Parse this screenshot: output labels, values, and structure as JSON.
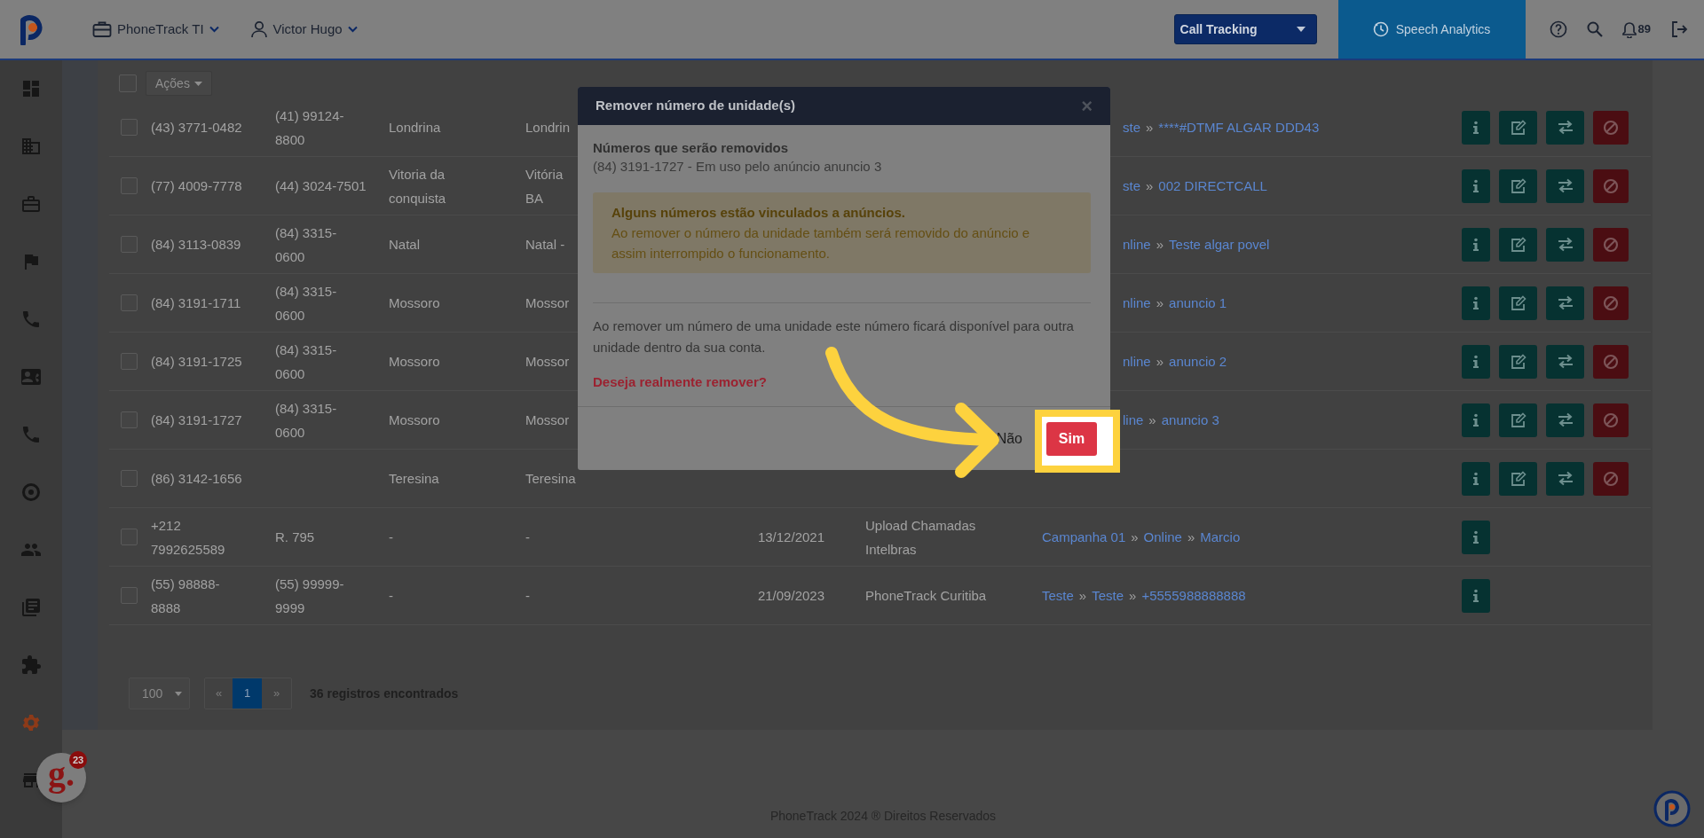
{
  "topbar": {
    "account": "PhoneTrack TI",
    "user": "Victor Hugo",
    "product_select": "Call Tracking",
    "speech_button": "Speech Analytics",
    "notifications": "89"
  },
  "sidebar": {
    "items": [
      {
        "kind": "dashboard",
        "selected": false
      },
      {
        "kind": "building",
        "selected": false
      },
      {
        "kind": "briefcase",
        "selected": false
      },
      {
        "kind": "flag",
        "selected": false
      },
      {
        "kind": "phone",
        "selected": false
      },
      {
        "kind": "contact",
        "selected": false
      },
      {
        "kind": "phone",
        "selected": false
      },
      {
        "kind": "target",
        "selected": false
      },
      {
        "kind": "people",
        "selected": false
      },
      {
        "kind": "book",
        "selected": false
      },
      {
        "kind": "puzzle",
        "selected": false
      },
      {
        "kind": "gear",
        "selected": true
      },
      {
        "kind": "store",
        "selected": false
      }
    ]
  },
  "table": {
    "select_all": {
      "checked": false
    },
    "actions_button": "Ações",
    "rows": [
      {
        "checked": false,
        "cells": [
          "(43) 3771-0482",
          [
            "(41) 99124-",
            "8800"
          ],
          "Londrina",
          "Londrin"
        ],
        "links": {
          "clipped": true,
          "parts": [
            "ste",
            "****#DTMF ALGAR DDD43"
          ]
        },
        "actions": [
          {
            "kind": "info"
          },
          {
            "kind": "edit"
          },
          {
            "kind": "transfer"
          },
          {
            "kind": "block"
          }
        ]
      },
      {
        "checked": false,
        "cells": [
          "(77) 4009-7778",
          "(44) 3024-7501",
          [
            "Vitoria da",
            "conquista"
          ],
          [
            "Vitória",
            "BA"
          ]
        ],
        "links": {
          "clipped": true,
          "parts": [
            "ste",
            "002 DIRECTCALL"
          ]
        },
        "actions": [
          {
            "kind": "info"
          },
          {
            "kind": "edit"
          },
          {
            "kind": "transfer"
          },
          {
            "kind": "block"
          }
        ]
      },
      {
        "checked": false,
        "cells": [
          "(84) 3113-0839",
          [
            "(84) 3315-",
            "0600"
          ],
          "Natal",
          "Natal -"
        ],
        "links": {
          "clipped": true,
          "parts": [
            "nline",
            "Teste algar povel"
          ]
        },
        "actions": [
          {
            "kind": "info"
          },
          {
            "kind": "edit"
          },
          {
            "kind": "transfer"
          },
          {
            "kind": "block"
          }
        ]
      },
      {
        "checked": false,
        "cells": [
          "(84) 3191-1711",
          [
            "(84) 3315-",
            "0600"
          ],
          "Mossoro",
          "Mossor"
        ],
        "links": {
          "clipped": true,
          "parts": [
            "nline",
            "anuncio 1"
          ]
        },
        "actions": [
          {
            "kind": "info"
          },
          {
            "kind": "edit"
          },
          {
            "kind": "transfer"
          },
          {
            "kind": "block"
          }
        ]
      },
      {
        "checked": false,
        "cells": [
          "(84) 3191-1725",
          [
            "(84) 3315-",
            "0600"
          ],
          "Mossoro",
          "Mossor"
        ],
        "links": {
          "clipped": true,
          "parts": [
            "nline",
            "anuncio 2"
          ]
        },
        "actions": [
          {
            "kind": "info"
          },
          {
            "kind": "edit"
          },
          {
            "kind": "transfer"
          },
          {
            "kind": "block"
          }
        ]
      },
      {
        "checked": false,
        "cells": [
          "(84) 3191-1727",
          [
            "(84) 3315-",
            "0600"
          ],
          "Mossoro",
          "Mossor"
        ],
        "links": {
          "clipped": true,
          "parts": [
            "line",
            "anuncio 3"
          ]
        },
        "actions": [
          {
            "kind": "info"
          },
          {
            "kind": "edit"
          },
          {
            "kind": "transfer"
          },
          {
            "kind": "block"
          }
        ]
      },
      {
        "checked": false,
        "cells": [
          "(86) 3142-1656",
          "",
          "Teresina",
          "Teresina"
        ],
        "actions": [
          {
            "kind": "info"
          },
          {
            "kind": "edit"
          },
          {
            "kind": "transfer"
          },
          {
            "kind": "block"
          }
        ]
      },
      {
        "checked": false,
        "cells": [
          [
            "+212",
            "7992625589"
          ],
          "R. 795",
          "-",
          "-"
        ],
        "date": "13/12/2021",
        "source": [
          "Upload Chamadas",
          "Intelbras"
        ],
        "links": {
          "parts": [
            "Campanha 01",
            "Online",
            "Marcio"
          ]
        },
        "actions": [
          {
            "kind": "info"
          }
        ]
      },
      {
        "checked": false,
        "cells": [
          [
            "(55) 98888-",
            "8888"
          ],
          [
            "(55) 99999-",
            "9999"
          ],
          "-",
          "-"
        ],
        "date": "21/09/2023",
        "source": "PhoneTrack Curitiba",
        "links": {
          "parts": [
            "Teste",
            "Teste",
            "+5555988888888"
          ]
        },
        "actions": [
          {
            "kind": "info"
          }
        ]
      }
    ],
    "link_separator": "»"
  },
  "pagination": {
    "page_size": "100",
    "prev": "«",
    "pages": [
      {
        "label": "1",
        "selected": true
      }
    ],
    "next": "»",
    "count": "36 registros encontrados"
  },
  "footer": "PhoneTrack 2024 ® Direitos Reservados",
  "chat_widget": {
    "logo": "g.",
    "badge": "23"
  },
  "modal": {
    "title": "Remover número de unidade(s)",
    "close": "×",
    "heading": "Números que serão removidos",
    "item": "(84) 3191-1727 - Em uso pelo anúncio anuncio 3",
    "warning": {
      "title": "Alguns números estão vinculados a anúncios.",
      "text": "Ao remover o número da unidade também será removido do anúncio e assim interrompido o funcionamento."
    },
    "info": "Ao remover um número de uma unidade este número ficará disponível para outra unidade dentro da sua conta.",
    "question": "Deseja realmente remover?",
    "cancel": "Não",
    "confirm": "Sim"
  }
}
